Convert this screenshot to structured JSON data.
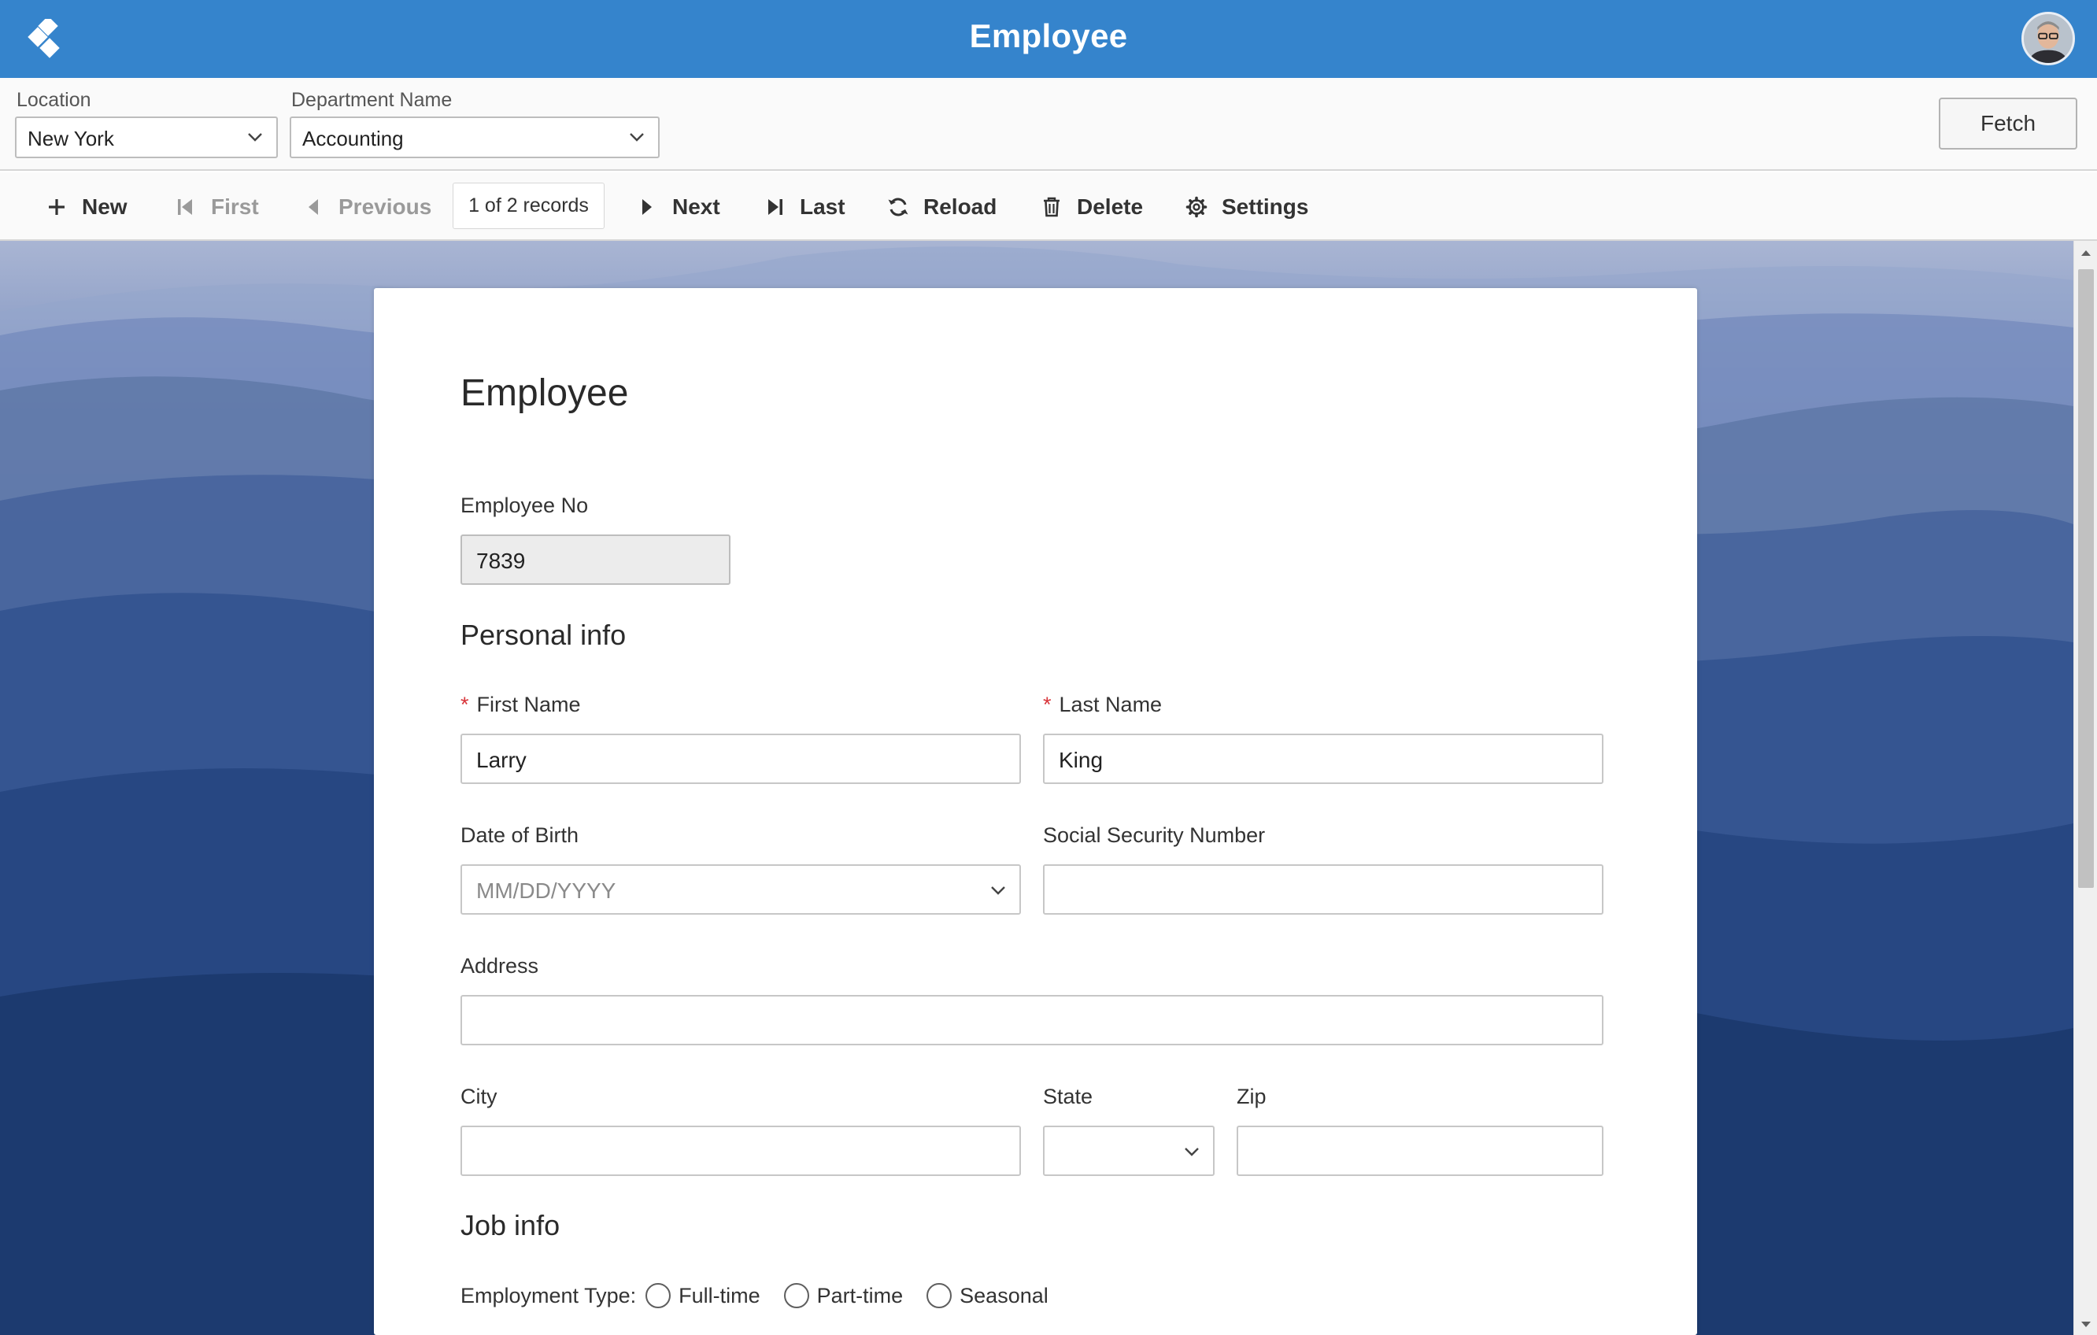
{
  "app": {
    "title": "Employee"
  },
  "filters": {
    "location_label": "Location",
    "location_value": "New York",
    "department_label": "Department Name",
    "department_value": "Accounting",
    "fetch_label": "Fetch"
  },
  "toolbar": {
    "new_label": "New",
    "first_label": "First",
    "previous_label": "Previous",
    "records_text": "1 of 2 records",
    "next_label": "Next",
    "last_label": "Last",
    "reload_label": "Reload",
    "delete_label": "Delete",
    "settings_label": "Settings"
  },
  "form": {
    "title": "Employee",
    "employee_no_label": "Employee No",
    "employee_no_value": "7839",
    "personal_info_title": "Personal info",
    "first_name_label": "First Name",
    "first_name_value": "Larry",
    "last_name_label": "Last Name",
    "last_name_value": "King",
    "required_marker": "*",
    "dob_label": "Date of Birth",
    "dob_placeholder": "MM/DD/YYYY",
    "ssn_label": "Social Security Number",
    "ssn_value": "",
    "address_label": "Address",
    "address_value": "",
    "city_label": "City",
    "city_value": "",
    "state_label": "State",
    "state_value": "",
    "zip_label": "Zip",
    "zip_value": "",
    "job_info_title": "Job info",
    "employment_type_label": "Employment Type:",
    "employment_options": [
      "Full-time",
      "Part-time",
      "Seasonal"
    ]
  },
  "colors": {
    "appbar": "#3584cc",
    "required": "#d8353a",
    "background_top": "#a9b5d3",
    "background_bottom": "#162d5b"
  },
  "icons": {
    "logo": "app-logo-icon",
    "new": "plus-icon",
    "first": "skip-first-icon",
    "previous": "caret-left-icon",
    "next": "caret-right-icon",
    "last": "skip-last-icon",
    "reload": "refresh-icon",
    "delete": "trash-icon",
    "settings": "gear-icon"
  }
}
